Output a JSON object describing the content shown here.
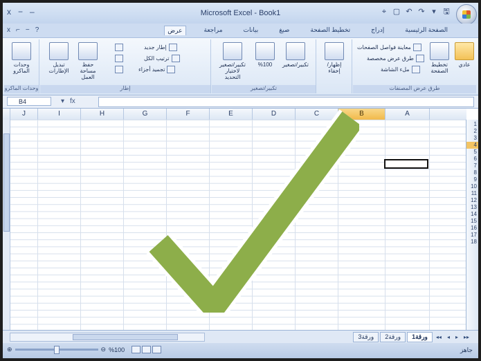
{
  "window": {
    "title": "Microsoft Excel - Book1"
  },
  "quick_access": {
    "items": [
      "⌖",
      "▢",
      "↶",
      "↷",
      "▾",
      "🖫"
    ]
  },
  "window_controls": {
    "items": [
      "x",
      "−",
      "–"
    ]
  },
  "help_controls": {
    "items": [
      "x",
      "⌐",
      "−",
      "?"
    ]
  },
  "tabs": [
    {
      "label": "الصفحة الرئيسية",
      "active": false
    },
    {
      "label": "إدراج",
      "active": false
    },
    {
      "label": "تخطيط الصفحة",
      "active": false
    },
    {
      "label": "صيغ",
      "active": false
    },
    {
      "label": "بيانات",
      "active": false
    },
    {
      "label": "مراجعة",
      "active": false
    },
    {
      "label": "عرض",
      "active": true
    }
  ],
  "ribbon": {
    "groups": [
      {
        "name": "طرق عرض المصنفات",
        "items": [
          "عادي",
          "تخطيط الصفحة",
          "معاينة فواصل الصفحات",
          "طرق عرض مخصصة",
          "ملء الشاشة"
        ]
      },
      {
        "name": "إظهار/إخفاء",
        "items": [
          "إظهار/إخفاء"
        ]
      },
      {
        "name": "تكبير/تصغير",
        "items": [
          "تكبير/تصغير",
          "%100",
          "تكبير/تصغير لاختيار التحديد"
        ]
      },
      {
        "name": "إطار",
        "items": [
          "إطار جديد",
          "ترتيب الكل",
          "تجميد أجزاء",
          "حفظ مساحة العمل",
          "تبديل الإطارات"
        ]
      },
      {
        "name": "وحدات الماكرو",
        "items": [
          "وحدات الماكرو"
        ]
      }
    ]
  },
  "formula_bar": {
    "name_box": "B4",
    "fx": "fx",
    "content": ""
  },
  "grid": {
    "columns": [
      "J",
      "I",
      "H",
      "G",
      "F",
      "E",
      "D",
      "C",
      "B",
      "A"
    ],
    "selected_column": "B",
    "rows": [
      "1",
      "2",
      "3",
      "4",
      "5",
      "6",
      "7",
      "8",
      "9",
      "10",
      "11",
      "12",
      "13",
      "14",
      "15",
      "16",
      "17",
      "18"
    ],
    "selected_row": "4"
  },
  "sheets": {
    "tabs": [
      "ورقة1",
      "ورقة2",
      "ورقة3"
    ],
    "active": "ورقة1",
    "nav": [
      "◂◂",
      "◂",
      "▸",
      "▸▸"
    ]
  },
  "status": {
    "ready": "جاهز",
    "zoom": "%100"
  },
  "overlay": {
    "icon": "checkmark-icon",
    "color": "#8dae4a"
  }
}
